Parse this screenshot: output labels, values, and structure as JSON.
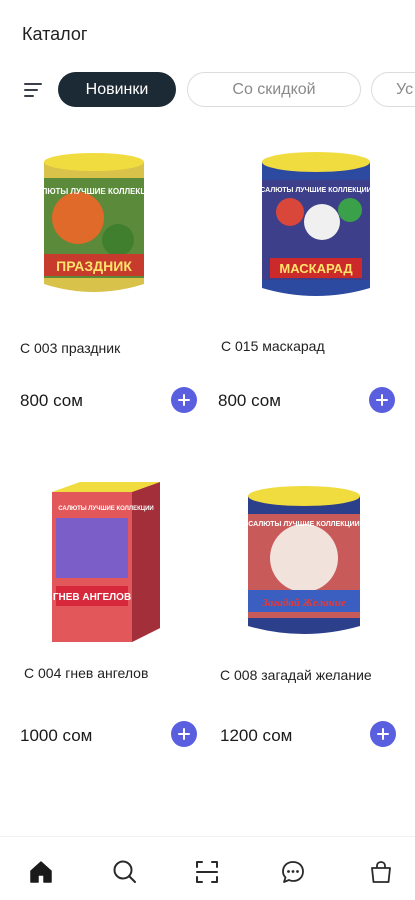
{
  "header": {
    "title": "Каталог"
  },
  "filters": {
    "menu_icon": "filter-lines-icon",
    "chips": [
      {
        "label": "Новинки",
        "active": true
      },
      {
        "label": "Со скидкой",
        "active": false
      },
      {
        "label": "Ус",
        "active": false
      }
    ]
  },
  "products": [
    {
      "name": "С 003 праздник",
      "price": "800 сом",
      "image_text": "ПРАЗДНИК",
      "brand_text": "САЛЮТЫ ЛУЧШИЕ КОЛЛЕКЦИИ"
    },
    {
      "name": "С 015 маскарад",
      "price": "800 сом",
      "image_text": "МАСКАРАД",
      "brand_text": "САЛЮТЫ ЛУЧШИЕ КОЛЛЕКЦИИ"
    },
    {
      "name": "С 004 гнев ангелов",
      "price": "1000 сом",
      "image_text": "ГНЕВ АНГЕЛОВ",
      "brand_text": "САЛЮТЫ ЛУЧШИЕ КОЛЛЕКЦИИ"
    },
    {
      "name": "С 008 загадай желание",
      "price": "1200 сом",
      "image_text": "Загадай Желание",
      "brand_text": "САЛЮТЫ ЛУЧШИЕ КОЛЛЕКЦИИ"
    }
  ],
  "bottom_nav": [
    {
      "icon": "home-icon",
      "active": true
    },
    {
      "icon": "search-icon",
      "active": false
    },
    {
      "icon": "scan-icon",
      "active": false
    },
    {
      "icon": "chat-icon",
      "active": false
    },
    {
      "icon": "bag-icon",
      "active": false
    }
  ],
  "colors": {
    "accent": "#5a5fe0",
    "chip_active": "#1c2a35"
  }
}
